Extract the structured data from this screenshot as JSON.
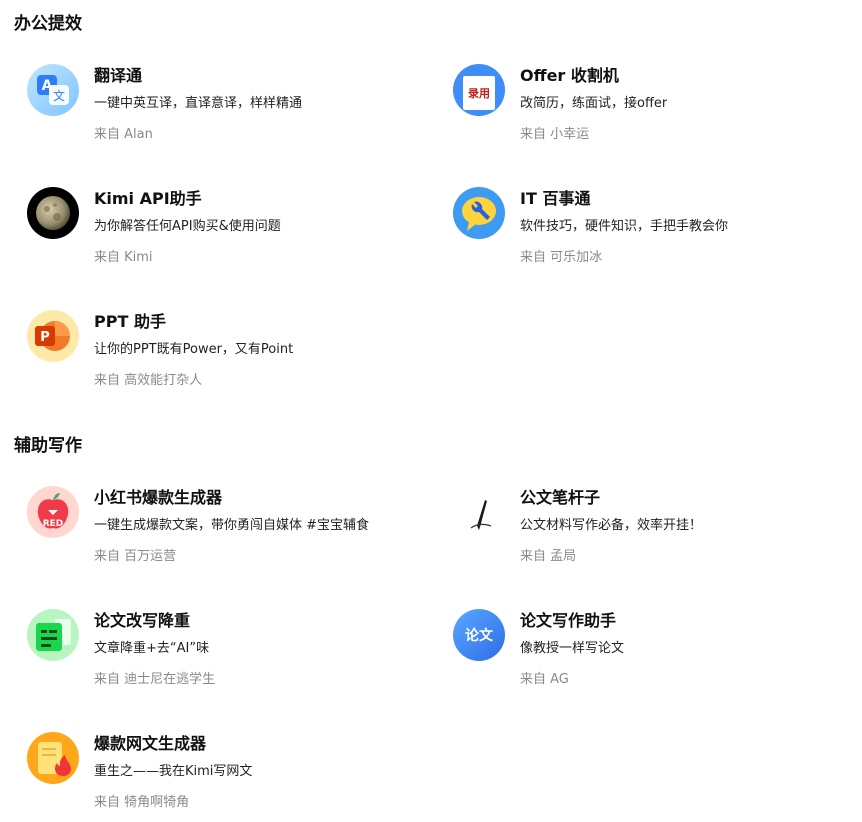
{
  "sections": [
    {
      "title": "办公提效",
      "cards": [
        {
          "name": "翻译通",
          "desc": "一键中英互译，直译意译，样样精通",
          "author": "来自 Alan",
          "icon": "translate-icon",
          "badge": "文"
        },
        {
          "name": "Offer 收割机",
          "desc": "改简历，练面试，接offer",
          "author": "来自 小幸运",
          "icon": "offer-stamp-icon",
          "badge": "录用"
        },
        {
          "name": "Kimi API助手",
          "desc": "为你解答任何API购买&使用问题",
          "author": "来自 Kimi",
          "icon": "moon-icon"
        },
        {
          "name": "IT 百事通",
          "desc": "软件技巧，硬件知识，手把手教会你",
          "author": "来自 可乐加冰",
          "icon": "wrench-chat-icon"
        },
        {
          "name": "PPT 助手",
          "desc": "让你的PPT既有Power，又有Point",
          "author": "来自 高效能打杂人",
          "icon": "powerpoint-icon",
          "badge": "P"
        }
      ]
    },
    {
      "title": "辅助写作",
      "cards": [
        {
          "name": "小红书爆款生成器",
          "desc": "一键生成爆款文案，带你勇闯自媒体 #宝宝辅食",
          "author": "来自 百万运营",
          "icon": "red-apple-icon",
          "badge": "RED"
        },
        {
          "name": "公文笔杆子",
          "desc": "公文材料写作必备，效率开挂！",
          "author": "来自 孟局",
          "icon": "fountain-pen-icon"
        },
        {
          "name": "论文改写降重",
          "desc": "文章降重+去“AI”味",
          "author": "来自 迪士尼在逃学生",
          "icon": "document-rewrite-icon"
        },
        {
          "name": "论文写作助手",
          "desc": "像教授一样写论文",
          "author": "来自 AG",
          "icon": "paper-writing-icon",
          "badge": "论文"
        },
        {
          "name": "爆款网文生成器",
          "desc": "重生之——我在Kimi写网文",
          "author": "来自 犄角啊犄角",
          "icon": "flame-document-icon"
        }
      ]
    }
  ],
  "colors": {
    "title": "#111111",
    "desc": "#222222",
    "author": "#8a8a8a"
  }
}
